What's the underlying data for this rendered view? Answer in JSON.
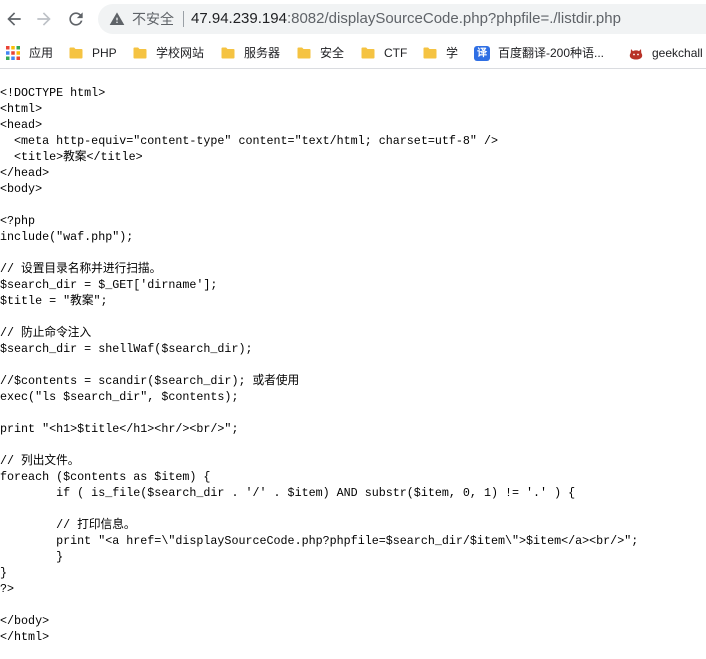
{
  "browser": {
    "nav": {
      "back_icon": "arrow-back-icon",
      "forward_icon": "arrow-forward-icon",
      "reload_icon": "reload-icon"
    },
    "address_bar": {
      "security_icon": "warning-icon",
      "security_label": "不安全",
      "url_host": "47.94.239.194",
      "url_rest": ":8082/displaySourceCode.php?phpfile=./listdir.php"
    },
    "bookmarks": [
      {
        "label": "应用",
        "icon": "apps-icon"
      },
      {
        "label": "PHP",
        "icon": "folder-icon"
      },
      {
        "label": "学校网站",
        "icon": "folder-icon"
      },
      {
        "label": "服务器",
        "icon": "folder-icon"
      },
      {
        "label": "安全",
        "icon": "folder-icon"
      },
      {
        "label": "CTF",
        "icon": "folder-icon"
      },
      {
        "label": "学",
        "icon": "folder-icon"
      },
      {
        "label": "百度翻译-200种语...",
        "icon": "translate-icon",
        "icon_glyph": "译"
      },
      {
        "label": "geekchall",
        "icon": "favicon-icon"
      }
    ]
  },
  "colors": {
    "primary_text": "#202124",
    "muted_text": "#5f6368",
    "disabled_icon": "#bdc1c6",
    "omnibox_background": "#f1f3f4",
    "folder": "#f5c342",
    "translate_blue": "#2f6fe4"
  },
  "page": {
    "source_lines": [
      "<!DOCTYPE html>",
      "<html>",
      "<head>",
      "  <meta http-equiv=\"content-type\" content=\"text/html; charset=utf-8\" />",
      "  <title>教案</title>",
      "</head>",
      "<body>",
      "",
      "<?php",
      "include(\"waf.php\");",
      "",
      "// 设置目录名称并进行扫描。",
      "$search_dir = $_GET['dirname'];",
      "$title = \"教案\";",
      "",
      "// 防止命令注入",
      "$search_dir = shellWaf($search_dir);",
      "",
      "//$contents = scandir($search_dir); 或者使用",
      "exec(\"ls $search_dir\", $contents);",
      "",
      "print \"<h1>$title</h1><hr/><br/>\";",
      "",
      "// 列出文件。",
      "foreach ($contents as $item) {",
      "        if ( is_file($search_dir . '/' . $item) AND substr($item, 0, 1) != '.' ) {",
      "",
      "        // 打印信息。",
      "        print \"<a href=\\\"displaySourceCode.php?phpfile=$search_dir/$item\\\">$item</a><br/>\";",
      "        }",
      "}",
      "?>",
      "",
      "</body>",
      "</html>"
    ]
  }
}
